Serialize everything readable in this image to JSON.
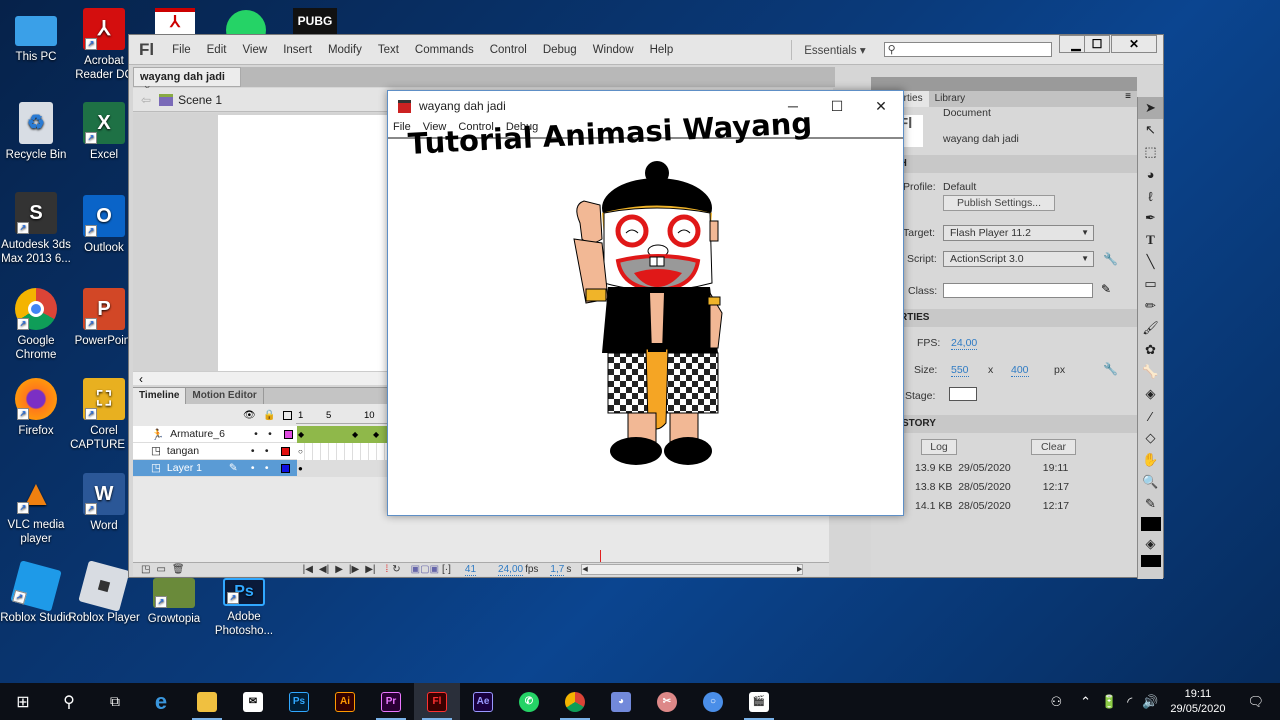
{
  "desktop": {
    "icons": [
      {
        "label": "This PC",
        "name": "this-pc"
      },
      {
        "label": "Acrobat Reader DC",
        "name": "acrobat-reader"
      },
      {
        "label": "Recycle Bin",
        "name": "recycle-bin"
      },
      {
        "label": "Excel",
        "name": "excel"
      },
      {
        "label": "Autodesk 3ds Max 2013 6...",
        "name": "3ds-max"
      },
      {
        "label": "Outlook",
        "name": "outlook"
      },
      {
        "label": "Google Chrome",
        "name": "google-chrome"
      },
      {
        "label": "PowerPoint",
        "name": "powerpoint"
      },
      {
        "label": "Firefox",
        "name": "firefox"
      },
      {
        "label": "Corel CAPTURE ...",
        "name": "corel-capture"
      },
      {
        "label": "VLC media player",
        "name": "vlc"
      },
      {
        "label": "Word",
        "name": "word"
      },
      {
        "label": "Roblox Studio",
        "name": "roblox-studio"
      },
      {
        "label": "Roblox Player",
        "name": "roblox-player"
      },
      {
        "label": "Growtopia",
        "name": "growtopia"
      },
      {
        "label": "Adobe Photosho...",
        "name": "photoshop"
      }
    ],
    "top_icons": [
      "Acrobat",
      "WhatsApp",
      "PUBG"
    ]
  },
  "flash": {
    "logo": "Fl",
    "menu": [
      "File",
      "Edit",
      "View",
      "Insert",
      "Modify",
      "Text",
      "Commands",
      "Control",
      "Debug",
      "Window",
      "Help"
    ],
    "workspace": "Essentials",
    "search_placeholder": "",
    "doc_tab": "wayang dah jadi",
    "doc_tab_close": "×",
    "scene": "Scene 1",
    "timeline": {
      "tabs": [
        "Timeline",
        "Motion Editor"
      ],
      "frame_numbers": [
        "1",
        "5",
        "10"
      ],
      "layers": [
        {
          "name": "Armature_6",
          "color": "#e04ce0",
          "type": "armature"
        },
        {
          "name": "tangan",
          "color": "#e01010",
          "type": "layer"
        },
        {
          "name": "Layer 1",
          "color": "#1010e0",
          "type": "layer",
          "selected": true
        }
      ],
      "current_frame": "41",
      "fps": "24,00",
      "fps_unit": "fps",
      "elapsed": "1,7",
      "elapsed_unit": "s"
    },
    "panel": {
      "tabs": [
        "Properties",
        "Library"
      ],
      "doc_type": "Document",
      "doc_name": "wayang dah jadi",
      "publish_header": "PUBLISH",
      "profile_label": "Profile:",
      "profile_value": "Default",
      "publish_settings_btn": "Publish Settings...",
      "target_label": "Target:",
      "target_value": "Flash Player 11.2",
      "script_label": "Script:",
      "script_value": "ActionScript 3.0",
      "class_label": "Class:",
      "class_value": "",
      "properties_header": "PROPERTIES",
      "fps_label": "FPS:",
      "fps_value": "24,00",
      "size_label": "Size:",
      "width": "550",
      "x": "x",
      "height": "400",
      "px": "px",
      "stage_label": "Stage:",
      "stage_color": "#ffffff",
      "swf_header": "SWF HISTORY",
      "log_btn": "Log",
      "clear_btn": "Clear",
      "history": [
        {
          "size": "13.9 KB",
          "date": "29/05/2020",
          "time": "19:11"
        },
        {
          "size": "13.8 KB",
          "date": "28/05/2020",
          "time": "12:17"
        },
        {
          "size": "14.1 KB",
          "date": "28/05/2020",
          "time": "12:17"
        }
      ]
    }
  },
  "player": {
    "title": "wayang dah jadi",
    "menu": [
      "File",
      "View",
      "Control",
      "Debug"
    ],
    "heading": "Tutorial Animasi Wayang"
  },
  "taskbar": {
    "apps": [
      "Start",
      "Search",
      "Task View",
      "Edge",
      "File Explorer",
      "Mail",
      "Photoshop",
      "Illustrator",
      "Premiere",
      "Flash",
      "After Effects",
      "WhatsApp",
      "Chrome",
      "Discord",
      "Snipping",
      "Chromium",
      "Clapper"
    ],
    "time": "19:11",
    "date": "29/05/2020"
  }
}
